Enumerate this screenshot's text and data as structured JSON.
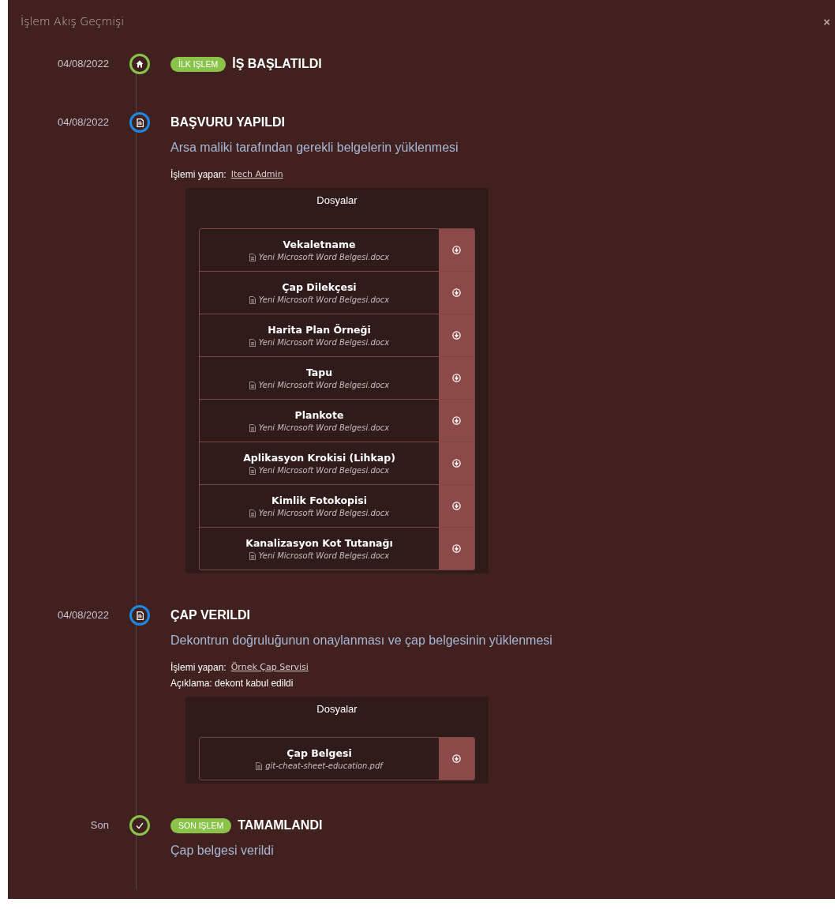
{
  "window": {
    "title": "İşlem Akış Geçmişi",
    "close": "×"
  },
  "events": [
    {
      "kind": "start",
      "date": "04/08/2022",
      "badge": "İLK IŞLEM",
      "title": "İŞ BAŞLATILDI"
    },
    {
      "kind": "step",
      "date": "04/08/2022",
      "title": "BAŞVURU YAPILDI",
      "description": "Arsa maliki tarafından gerekli belgelerin yüklenmesi",
      "operator_label": "İşlemi yapan:",
      "operator": "Itech Admin",
      "files_title": "Dosyalar",
      "files": [
        {
          "name": "Vekaletname",
          "file": "Yeni Microsoft Word Belgesi.docx"
        },
        {
          "name": "Çap Dilekçesi",
          "file": "Yeni Microsoft Word Belgesi.docx"
        },
        {
          "name": "Harita Plan Örneği",
          "file": "Yeni Microsoft Word Belgesi.docx"
        },
        {
          "name": "Tapu",
          "file": "Yeni Microsoft Word Belgesi.docx"
        },
        {
          "name": "Plankote",
          "file": "Yeni Microsoft Word Belgesi.docx"
        },
        {
          "name": "Aplikasyon Krokisi (Lihkap)",
          "file": "Yeni Microsoft Word Belgesi.docx"
        },
        {
          "name": "Kimlik Fotokopisi",
          "file": "Yeni Microsoft Word Belgesi.docx"
        },
        {
          "name": "Kanalizasyon Kot Tutanağı",
          "file": "Yeni Microsoft Word Belgesi.docx"
        }
      ]
    },
    {
      "kind": "step",
      "date": "04/08/2022",
      "title": "ÇAP VERILDI",
      "description": "Dekontrun doğruluğunun onaylanması ve çap belgesinin yüklenmesi",
      "operator_label": "İşlemi yapan:",
      "operator": "Örnek Çap Servisi",
      "note": "Açıklama: dekont kabul edildi",
      "files_title": "Dosyalar",
      "files": [
        {
          "name": "Çap Belgesi",
          "file": "git-cheat-sheet-education.pdf"
        }
      ]
    },
    {
      "kind": "end",
      "date": "Son",
      "badge": "SON IŞLEM",
      "title": "TAMAMLANDI",
      "description": "Çap belgesi verildi"
    }
  ]
}
